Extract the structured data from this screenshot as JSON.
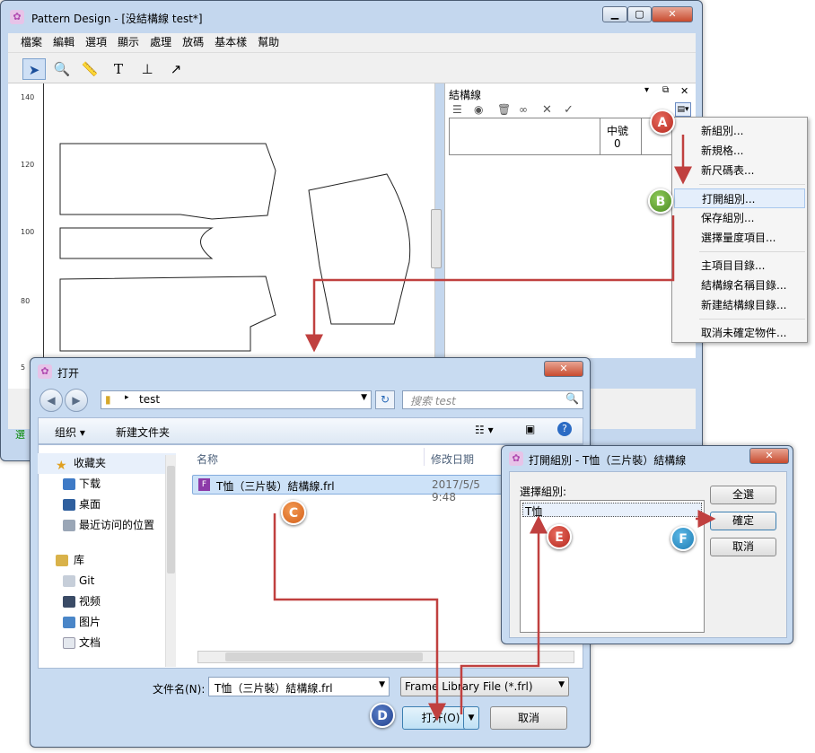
{
  "main_window": {
    "title": "Pattern Design - [没結構線 test*]",
    "menu": [
      "檔案",
      "編輯",
      "選項",
      "顯示",
      "處理",
      "放碼",
      "基本樣",
      "幫助"
    ],
    "ruler_labels": [
      "140",
      "120",
      "100",
      "80",
      "5"
    ],
    "status_text": "選"
  },
  "side_panel": {
    "title": "結構線",
    "column_header": "中號",
    "column_value": "0"
  },
  "context_menu": {
    "items": [
      "新組別...",
      "新規格...",
      "新尺碼表...",
      "打開組別...",
      "保存組別...",
      "選擇量度項目...",
      "主項目目錄...",
      "結構線名稱目錄...",
      "新建結構線目錄...",
      "取消未確定物件..."
    ]
  },
  "open_dialog": {
    "title": "打开",
    "path": "test",
    "search_placeholder": "搜索 test",
    "toolbar": {
      "organize": "组织 ▾",
      "new_folder": "新建文件夹"
    },
    "nav": {
      "favorites": "收藏夹",
      "favorites_items": [
        "下载",
        "桌面",
        "最近访问的位置"
      ],
      "library": "库",
      "library_items": [
        "Git",
        "视频",
        "图片",
        "文档"
      ]
    },
    "columns": {
      "name": "名称",
      "modified": "修改日期"
    },
    "file": {
      "name": "T恤（三片裝）結構線.frl",
      "date": "2017/5/5 9:48"
    },
    "filename_label": "文件名(N):",
    "filename_value": "T恤（三片裝）結構線.frl",
    "filetype": "Frame Library File (*.frl)",
    "open_button": "打开(O)",
    "cancel_button": "取消"
  },
  "group_dialog": {
    "title": "打開組別 - T恤（三片裝）結構線",
    "label": "選擇組別:",
    "selected": "T恤",
    "select_all": "全選",
    "ok": "確定",
    "cancel": "取消"
  },
  "markers": [
    "A",
    "B",
    "C",
    "D",
    "E",
    "F"
  ],
  "colors": {
    "marker_red": "#c9372b",
    "marker_green": "#5a9d2c",
    "marker_orange": "#e0691f",
    "marker_blue": "#2a8ac2",
    "arrow": "#c0403f"
  }
}
